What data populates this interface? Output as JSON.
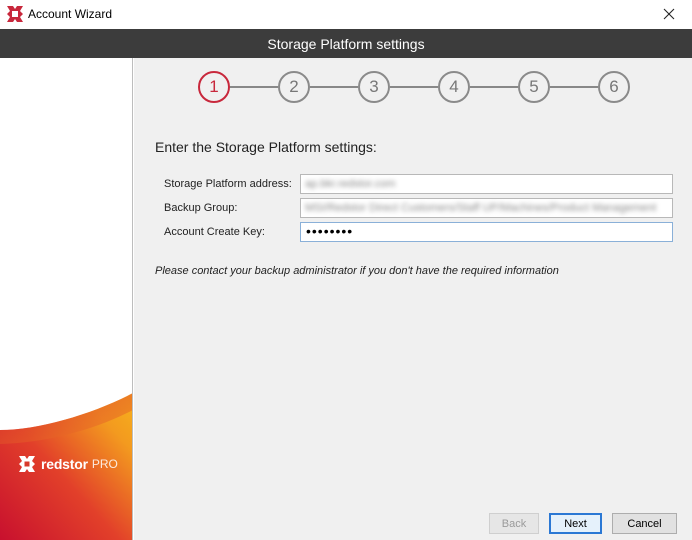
{
  "window": {
    "title": "Account Wizard",
    "app_icon": "redstor-logo-icon",
    "close_icon": "close-icon"
  },
  "header": {
    "title": "Storage Platform settings"
  },
  "stepper": {
    "steps": [
      "1",
      "2",
      "3",
      "4",
      "5",
      "6"
    ],
    "active_step": 1
  },
  "form": {
    "heading": "Enter the Storage Platform settings:",
    "fields": [
      {
        "label": "Storage Platform address:",
        "value": "ap.bkr.redstor.com"
      },
      {
        "label": "Backup Group:",
        "value": "MSI/Redstor Direct Customers/Staff UP/Machines/Product Management"
      },
      {
        "label": "Account Create Key:",
        "value": "••••••••"
      }
    ],
    "note": "Please contact your backup administrator if you don't have the required information"
  },
  "brand": {
    "name": "redstor",
    "suffix": "PRO"
  },
  "buttons": {
    "back": "Back",
    "next": "Next",
    "cancel": "Cancel"
  },
  "colors": {
    "header_bg": "#3c3c3c",
    "accent_red": "#c8283c",
    "main_bg": "#f0f0f0",
    "focus_blue": "#2b78d4"
  }
}
